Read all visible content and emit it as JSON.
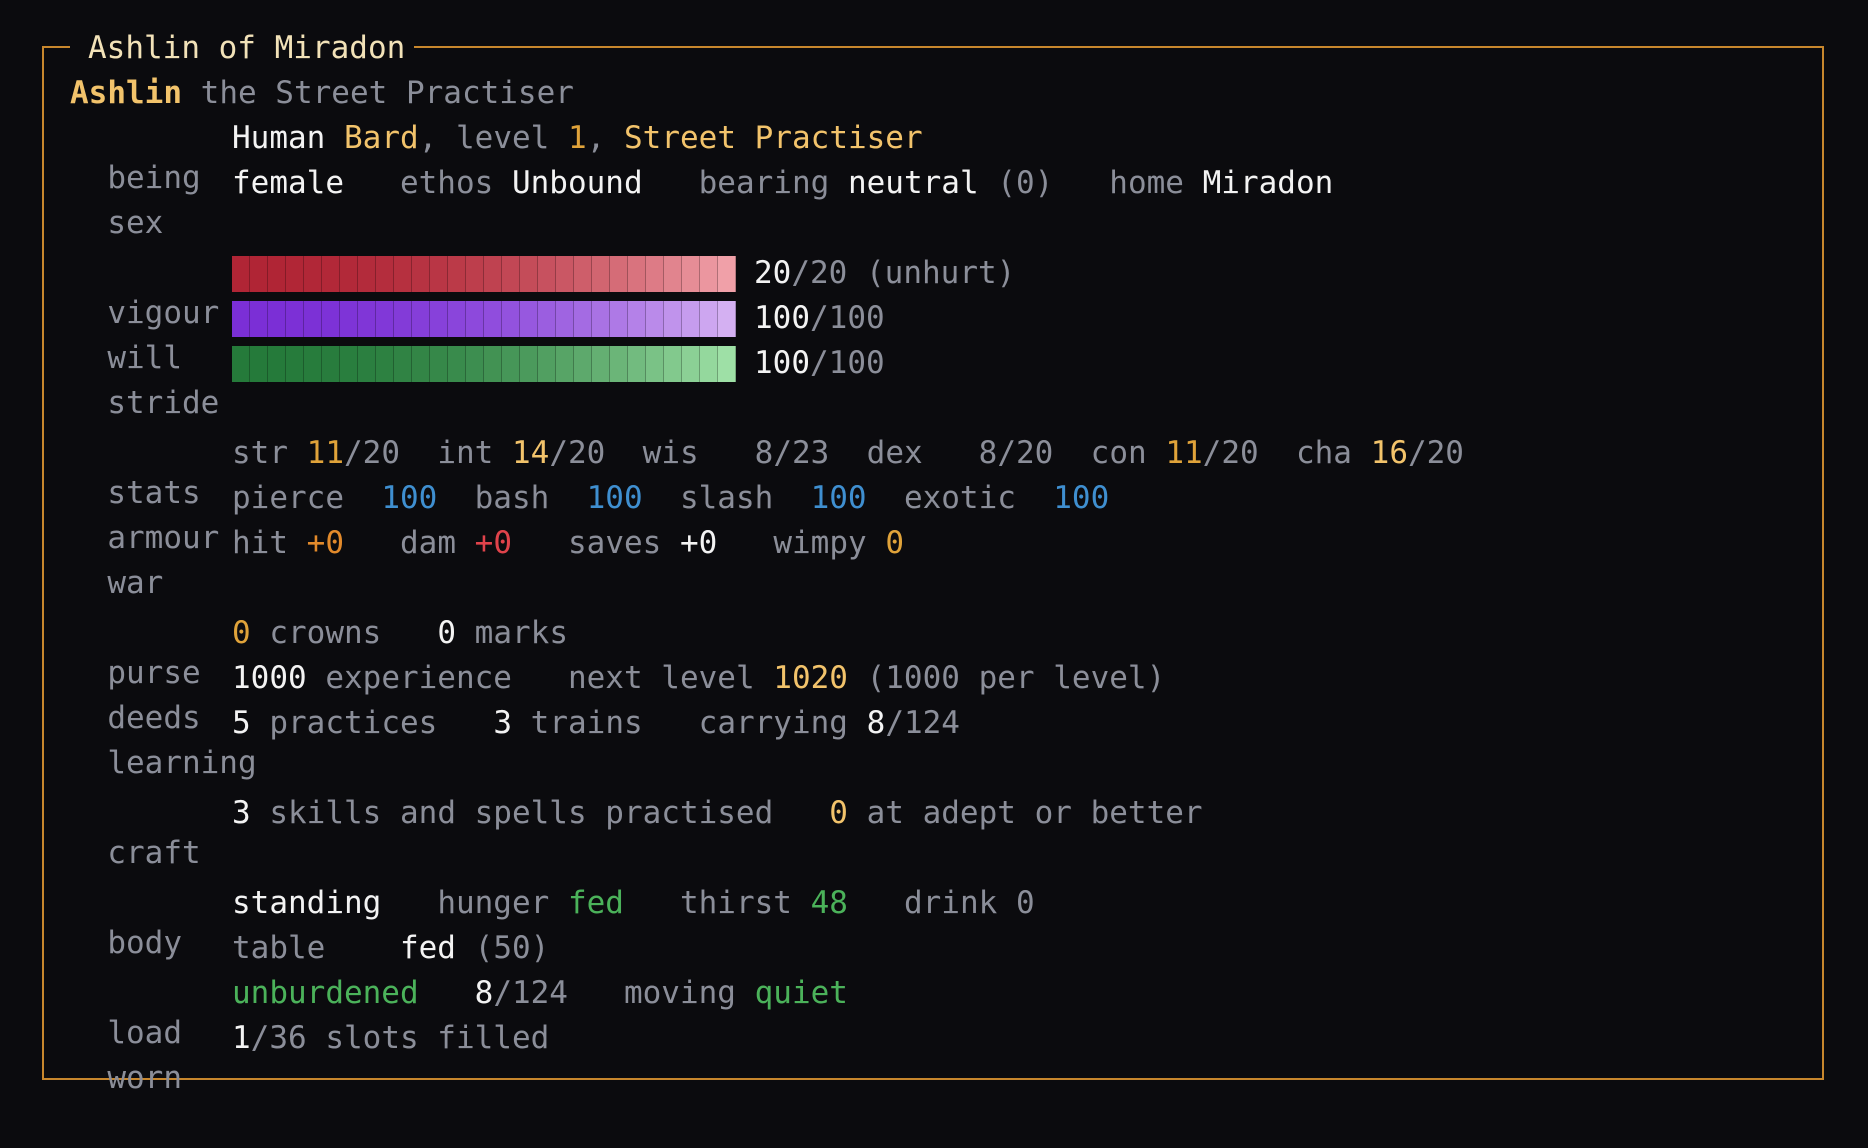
{
  "title": "Ashlin of Miradon",
  "header": {
    "name": "Ashlin",
    "epithet": "the Street Practiser"
  },
  "being": {
    "label": "being",
    "race": "Human",
    "class": "Bard",
    "sep1": ",",
    "level_word": "level",
    "level": "1",
    "sep2": ",",
    "rank": "Street Practiser"
  },
  "sex_row": {
    "label": "sex",
    "sex": "female",
    "ethos_label": "ethos",
    "ethos": "Unbound",
    "bearing_label": "bearing",
    "bearing": "neutral",
    "bearing_num": "(0)",
    "home_label": "home",
    "home": "Miradon"
  },
  "vigour": {
    "label": "vigour",
    "current": "20",
    "max": "/20",
    "note": "(unhurt)",
    "fraction": 1.0
  },
  "will": {
    "label": "will",
    "current": "100",
    "max": "/100",
    "fraction": 1.0
  },
  "stride": {
    "label": "stride",
    "current": "100",
    "max": "/100",
    "fraction": 1.0
  },
  "bar_colors": {
    "vigour": [
      "#b02535",
      "#f0a0a8"
    ],
    "will": [
      "#7b2fd6",
      "#d4b0f2"
    ],
    "stride": [
      "#257a3a",
      "#9ee0a6"
    ]
  },
  "stats": {
    "label": "stats",
    "str_l": "str",
    "str_v": "11",
    "str_m": "/20",
    "int_l": "int",
    "int_v": "14",
    "int_m": "/20",
    "wis_l": "wis",
    "wis_v": "8",
    "wis_m": "/23",
    "dex_l": "dex",
    "dex_v": "8",
    "dex_m": "/20",
    "con_l": "con",
    "con_v": "11",
    "con_m": "/20",
    "cha_l": "cha",
    "cha_v": "16",
    "cha_m": "/20"
  },
  "armour": {
    "label": "armour",
    "pierce_l": "pierce",
    "pierce": "100",
    "bash_l": "bash",
    "bash": "100",
    "slash_l": "slash",
    "slash": "100",
    "exotic_l": "exotic",
    "exotic": "100"
  },
  "war": {
    "label": "war",
    "hit_l": "hit",
    "hit": "+0",
    "dam_l": "dam",
    "dam": "+0",
    "saves_l": "saves",
    "saves": "+0",
    "wimpy_l": "wimpy",
    "wimpy": "0"
  },
  "purse": {
    "label": "purse",
    "crowns": "0",
    "crowns_l": "crowns",
    "marks": "0",
    "marks_l": "marks"
  },
  "deeds": {
    "label": "deeds",
    "exp": "1000",
    "exp_l": "experience",
    "next_l": "next level",
    "next": "1020",
    "per": "(1000 per level)"
  },
  "learning": {
    "label": "learning",
    "practices": "5",
    "practices_l": "practices",
    "trains": "3",
    "trains_l": "trains",
    "carry_l": "carrying",
    "carry": "8",
    "carry_max": "/124"
  },
  "craft": {
    "label": "craft",
    "skills": "3",
    "skills_l": "skills and spells practised",
    "adept": "0",
    "adept_l": "at adept or better"
  },
  "body": {
    "label": "body",
    "pos": "standing",
    "hunger_l": "hunger",
    "hunger": "fed",
    "thirst_l": "thirst",
    "thirst": "48",
    "drink_l": "drink",
    "drink": "0",
    "table_l": "table",
    "table": "fed",
    "table_num": "(50)"
  },
  "load": {
    "label": "load",
    "state": "unburdened",
    "cur": "8",
    "max": "/124",
    "moving_l": "moving",
    "moving": "quiet"
  },
  "worn": {
    "label": "worn",
    "filled": "1",
    "rest": "/36 slots filled"
  }
}
